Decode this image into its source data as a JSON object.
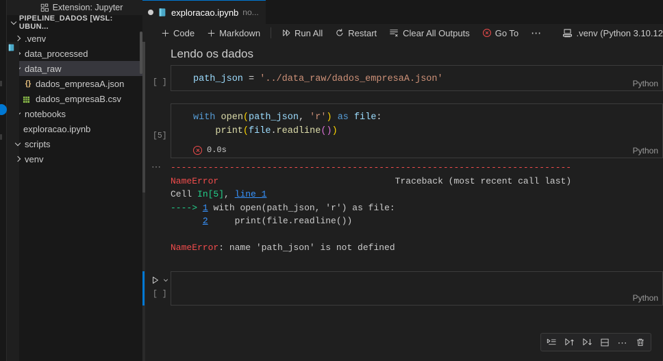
{
  "window": {
    "background": "#1f1f1f",
    "accent": "#0078d4"
  },
  "tab": {
    "name": "exploracao.ipynb",
    "suffix": "no...",
    "dirty": true,
    "icon": "notebook-icon"
  },
  "breadcrumb": {
    "icon": "extensions-icon",
    "label": "Extension: Jupyter"
  },
  "sidebar": {
    "header": "PIPELINE_DADOS [WSL: UBUN...",
    "items": [
      {
        "label": ".venv",
        "type": "folder",
        "state": "collapsed",
        "depth": 1,
        "icon": "chevron-right-icon"
      },
      {
        "label": "data_processed",
        "type": "folder",
        "state": "collapsed",
        "depth": 1,
        "icon": "chevron-right-icon"
      },
      {
        "label": "data_raw",
        "type": "folder",
        "state": "expanded",
        "depth": 1,
        "icon": "chevron-down-icon",
        "selected": true
      },
      {
        "label": "dados_empresaA.json",
        "type": "json",
        "state": "file",
        "depth": 2,
        "icon": "json-file-icon",
        "glyph": "{}"
      },
      {
        "label": "dados_empresaB.csv",
        "type": "csv",
        "state": "file",
        "depth": 2,
        "icon": "csv-file-icon",
        "glyph": "▦"
      },
      {
        "label": "notebooks",
        "type": "folder",
        "state": "expanded",
        "depth": 1,
        "icon": "chevron-down-icon"
      },
      {
        "label": "exploracao.ipynb",
        "type": "ipynb",
        "state": "file",
        "depth": 2,
        "icon": "notebook-file-icon",
        "glyph": "■"
      },
      {
        "label": "scripts",
        "type": "folder",
        "state": "expanded",
        "depth": 1,
        "icon": "chevron-down-icon"
      },
      {
        "label": "venv",
        "type": "folder",
        "state": "collapsed",
        "depth": 1,
        "icon": "chevron-right-icon"
      }
    ]
  },
  "toolbar": {
    "buttons": [
      {
        "label": "Code",
        "icon": "plus-icon"
      },
      {
        "label": "Markdown",
        "icon": "plus-icon"
      },
      {
        "label": "Run All",
        "icon": "run-all-icon"
      },
      {
        "label": "Restart",
        "icon": "restart-icon"
      },
      {
        "label": "Clear All Outputs",
        "icon": "clear-outputs-icon"
      },
      {
        "label": "Go To",
        "icon": "goto-error-icon"
      },
      {
        "label": "⋯",
        "icon": "more-actions-icon"
      }
    ],
    "kernel": {
      "icon": "kernel-icon",
      "label": ".venv (Python 3.10.12"
    }
  },
  "notebook": {
    "markdown_cell": {
      "text": "Lendo os dados"
    },
    "cells": [
      {
        "exec_count": "[ ]",
        "language": "Python",
        "code_tokens": [
          [
            {
              "t": "path_json",
              "c": "var"
            },
            {
              "t": " ",
              "c": "plain"
            },
            {
              "t": "=",
              "c": "plain"
            },
            {
              "t": " ",
              "c": "plain"
            },
            {
              "t": "'../data_raw/dados_empresaA.json'",
              "c": "string"
            }
          ]
        ]
      },
      {
        "exec_count": "[5]",
        "language": "Python",
        "status": {
          "icon": "error-icon",
          "time": "0.0s"
        },
        "code_tokens": [
          [
            {
              "t": "with",
              "c": "kw"
            },
            {
              "t": " ",
              "c": "plain"
            },
            {
              "t": "open",
              "c": "fn"
            },
            {
              "t": "(",
              "c": "paren1"
            },
            {
              "t": "path_json",
              "c": "var"
            },
            {
              "t": ",",
              "c": "plain"
            },
            {
              "t": " ",
              "c": "plain"
            },
            {
              "t": "'r'",
              "c": "string"
            },
            {
              "t": ")",
              "c": "paren1"
            },
            {
              "t": " ",
              "c": "plain"
            },
            {
              "t": "as",
              "c": "kw"
            },
            {
              "t": " ",
              "c": "plain"
            },
            {
              "t": "file",
              "c": "var"
            },
            {
              "t": ":",
              "c": "plain"
            }
          ],
          [
            {
              "t": "    ",
              "c": "plain"
            },
            {
              "t": "print",
              "c": "fn"
            },
            {
              "t": "(",
              "c": "paren1"
            },
            {
              "t": "file",
              "c": "var"
            },
            {
              "t": ".",
              "c": "plain"
            },
            {
              "t": "readline",
              "c": "fn"
            },
            {
              "t": "(",
              "c": "paren2"
            },
            {
              "t": ")",
              "c": "paren2"
            },
            {
              "t": ")",
              "c": "paren1"
            }
          ]
        ],
        "output": {
          "gutter": "⋯",
          "lines": [
            [
              {
                "t": "---------------------------------------------------------------------------",
                "c": "red"
              }
            ],
            [
              {
                "t": "NameError",
                "c": "red"
              },
              {
                "t": "                                 ",
                "c": "white"
              },
              {
                "t": "Traceback (most recent call last)",
                "c": "white"
              }
            ],
            [
              {
                "t": "Cell ",
                "c": "white"
              },
              {
                "t": "In[5]",
                "c": "green"
              },
              {
                "t": ", ",
                "c": "white"
              },
              {
                "t": "line 1",
                "c": "link"
              }
            ],
            [
              {
                "t": "---->",
                "c": "green"
              },
              {
                "t": " ",
                "c": "white"
              },
              {
                "t": "1",
                "c": "link"
              },
              {
                "t": " with open(path_json, 'r') as file:",
                "c": "white"
              }
            ],
            [
              {
                "t": "      ",
                "c": "white"
              },
              {
                "t": "2",
                "c": "link"
              },
              {
                "t": "     print(file.readline())",
                "c": "white"
              }
            ],
            [
              {
                "t": "",
                "c": "white"
              }
            ],
            [
              {
                "t": "NameError",
                "c": "red"
              },
              {
                "t": ": name 'path_json' is not defined",
                "c": "white"
              }
            ]
          ]
        }
      },
      {
        "exec_count": "[ ]",
        "language": "Python",
        "focused": true,
        "empty": true,
        "code_tokens": []
      }
    ],
    "cell_toolbar": {
      "buttons": [
        {
          "icon": "run-by-line-icon",
          "name": "run-by-line"
        },
        {
          "icon": "run-above-icon",
          "name": "run-above"
        },
        {
          "icon": "run-below-icon",
          "name": "run-below"
        },
        {
          "icon": "split-cell-icon",
          "name": "split-cell"
        },
        {
          "icon": "more-actions-icon",
          "name": "more-actions",
          "glyph": "⋯"
        },
        {
          "icon": "trash-icon",
          "name": "delete-cell"
        }
      ]
    }
  },
  "syntax_colors": {
    "var": "#9cdcfe",
    "kw": "#569cd6",
    "fn": "#dcdcaa",
    "string": "#ce9178",
    "plain": "#d4d4d4",
    "paren1": "#ffd700",
    "paren2": "#da70d6"
  }
}
